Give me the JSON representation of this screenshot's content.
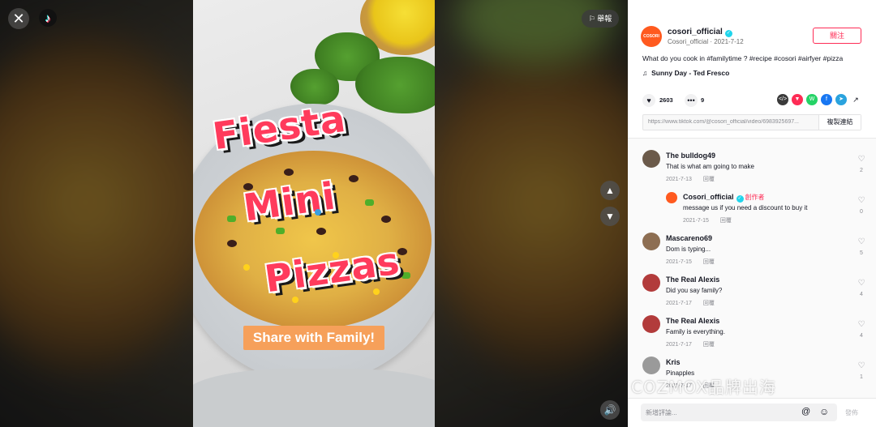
{
  "video": {
    "title_words": [
      "Fiesta",
      "Mini",
      "Pizzas"
    ],
    "overlay_text": "Share with Family!",
    "report_label": "舉報",
    "icons": {
      "close": "close-icon",
      "logo": "tiktok-logo-icon",
      "up": "chevron-up-icon",
      "down": "chevron-down-icon",
      "volume": "volume-icon",
      "flag": "flag-icon"
    }
  },
  "author": {
    "name": "cosori_official",
    "avatar_text": "COSORI",
    "handle": "Cosori_official",
    "date": "2021-7-12",
    "follow_label": "關注"
  },
  "post": {
    "caption_prefix": "What do you cook in ",
    "caption_tags": [
      "#familytime",
      "?",
      "#recipe",
      "#cosori",
      "#airfyer",
      "#pizza"
    ],
    "music": "Sunny Day - Ted Fresco",
    "likes": "2603",
    "comments": "9",
    "link": "https://www.tiktok.com/@cosori_official/video/6983925697...",
    "copy_label": "複製連結"
  },
  "share_icons": [
    {
      "name": "embed-icon",
      "color": "#3a3a3a",
      "glyph": "</>"
    },
    {
      "name": "friends-icon",
      "color": "#fe2c55",
      "glyph": "▼"
    },
    {
      "name": "whatsapp-icon",
      "color": "#25d366",
      "glyph": "W"
    },
    {
      "name": "facebook-icon",
      "color": "#1877f2",
      "glyph": "f"
    },
    {
      "name": "telegram-icon",
      "color": "#2aa3de",
      "glyph": "➤"
    },
    {
      "name": "more-share-icon",
      "color": "#161823",
      "glyph": "↗"
    }
  ],
  "comments": [
    {
      "name": "The bulldog49",
      "text": "That is what am going to make",
      "date": "2021-7-13",
      "reply": "回覆",
      "likes": "2",
      "avatar_color": "#6b5a4a"
    },
    {
      "name": "Cosori_official",
      "creator": "創作者",
      "text": "message us if you need a discount to buy it",
      "date": "2021-7-15",
      "reply": "回覆",
      "likes": "0",
      "avatar_color": "#ff5a1f",
      "is_reply": true
    },
    {
      "name": "Mascareno69",
      "text": "Dom is typing...",
      "date": "2021-7-15",
      "reply": "回覆",
      "likes": "5",
      "avatar_color": "#8d6e52"
    },
    {
      "name": "The Real Alexis",
      "text": "Did you say family?",
      "date": "2021-7-17",
      "reply": "回覆",
      "likes": "4",
      "avatar_color": "#b23b3b"
    },
    {
      "name": "The Real Alexis",
      "text": "Family is everything.",
      "date": "2021-7-17",
      "reply": "回覆",
      "likes": "4",
      "avatar_color": "#b23b3b"
    },
    {
      "name": "Kris",
      "text": "Pinapples",
      "date": "2021-7-17",
      "reply": "回覆",
      "likes": "1",
      "avatar_color": "#9a9a9a"
    }
  ],
  "input": {
    "placeholder": "新增評論...",
    "post_label": "發佈"
  },
  "watermark": "COZMOX品牌出海"
}
